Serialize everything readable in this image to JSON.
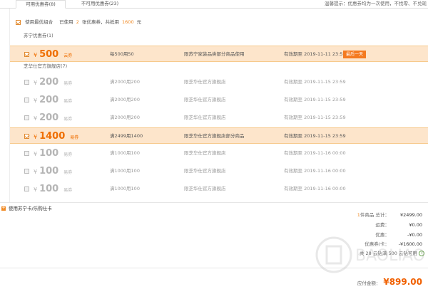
{
  "tabs": {
    "available": "可用优惠券(8)",
    "unavailable": "不可用优惠券(23)",
    "tip": "温馨提示：优惠券均为一次使用，不找零、不兑现"
  },
  "combo": {
    "label": "使用最优组合",
    "used_prefix": "已使用",
    "used_count": "2",
    "used_mid": "张优惠券，共抵用",
    "used_amount": "1600",
    "used_suffix": "元"
  },
  "groups": {
    "suning": "苏宁优惠券(1)",
    "zhifuzi": "芝华仕官方旗舰店(7)"
  },
  "coupons": [
    {
      "currency": "¥",
      "amount": "500",
      "type": "云券",
      "condition": "每500用50",
      "scope": "限苏宁家装品类部分商品使用",
      "validity": "有效期至 2019-11-11 23:59",
      "badge": "最后一天",
      "selected": true
    },
    {
      "currency": "¥",
      "amount": "200",
      "type": "易券",
      "condition": "满2000用200",
      "scope": "限芝华仕官方旗舰店",
      "validity": "有效期至 2019-11-15 23:59",
      "selected": false
    },
    {
      "currency": "¥",
      "amount": "200",
      "type": "易券",
      "condition": "满2000用200",
      "scope": "限芝华仕官方旗舰店",
      "validity": "有效期至 2019-11-15 23:59",
      "selected": false
    },
    {
      "currency": "¥",
      "amount": "200",
      "type": "易券",
      "condition": "满2000用200",
      "scope": "限芝华仕官方旗舰店",
      "validity": "有效期至 2019-11-15 23:59",
      "selected": false
    },
    {
      "currency": "¥",
      "amount": "1400",
      "type": "易券",
      "condition": "满2499用1400",
      "scope": "限芝华仕官方旗舰店部分商品",
      "validity": "有效期至 2019-11-15 23:59",
      "selected": true
    },
    {
      "currency": "¥",
      "amount": "100",
      "type": "易券",
      "condition": "满1000用100",
      "scope": "限芝华仕官方旗舰店",
      "validity": "有效期至 2019-11-16 00:00",
      "selected": false
    },
    {
      "currency": "¥",
      "amount": "100",
      "type": "易券",
      "condition": "满1000用100",
      "scope": "限芝华仕官方旗舰店",
      "validity": "有效期至 2019-11-16 00:00",
      "selected": false
    },
    {
      "currency": "¥",
      "amount": "100",
      "type": "易券",
      "condition": "满1000用100",
      "scope": "限芝华仕官方旗舰店",
      "validity": "有效期至 2019-11-16 00:00",
      "selected": false
    }
  ],
  "card": {
    "label": "使用苏宁卡/乐购仕卡"
  },
  "summary": {
    "items_count": "1",
    "items_label": "件商品 总计：",
    "items_total": "¥2499.00",
    "shipping_label": "运费：",
    "shipping": "¥0.00",
    "discount_label": "优惠：",
    "discount": "-¥0.00",
    "coupon_label": "优惠券/卡：",
    "coupon": "-¥1600.00",
    "points_text": "共 28 云钻满 500 云钻可用",
    "points_help": "?",
    "total_label": "应付金额：",
    "total": "¥899.00"
  },
  "watermark": {
    "text": "BAOLIAO"
  },
  "colors": {
    "accent": "#f08a24",
    "selected_bg": "#fde5cb",
    "badge": "#f47a20",
    "price": "#f06000"
  }
}
